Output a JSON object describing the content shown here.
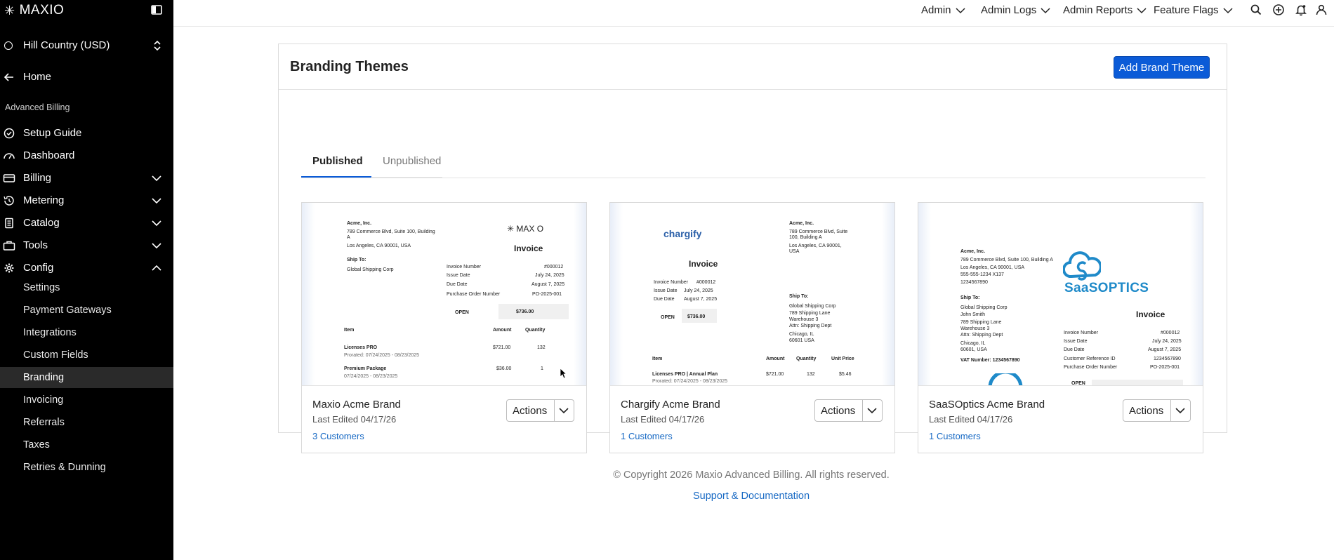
{
  "brand": {
    "name": "MAXIO",
    "mark": "✳"
  },
  "site": {
    "label": "Hill Country (USD)"
  },
  "nav": {
    "home": "Home",
    "section": "Advanced Billing",
    "items": [
      {
        "label": "Setup Guide"
      },
      {
        "label": "Dashboard"
      },
      {
        "label": "Billing"
      },
      {
        "label": "Metering"
      },
      {
        "label": "Catalog"
      },
      {
        "label": "Tools"
      },
      {
        "label": "Config"
      }
    ],
    "config_sub": [
      {
        "label": "Settings"
      },
      {
        "label": "Payment Gateways"
      },
      {
        "label": "Integrations"
      },
      {
        "label": "Custom Fields"
      },
      {
        "label": "Branding"
      },
      {
        "label": "Invoicing"
      },
      {
        "label": "Referrals"
      },
      {
        "label": "Taxes"
      },
      {
        "label": "Retries & Dunning"
      }
    ]
  },
  "topbar": {
    "menus": [
      "Admin",
      "Admin Logs",
      "Admin Reports",
      "Feature Flags"
    ]
  },
  "page": {
    "title": "Branding Themes",
    "add_button": "Add Brand Theme",
    "tabs": [
      "Published",
      "Unpublished"
    ]
  },
  "themes": [
    {
      "name": "Maxio Acme Brand",
      "edited": "Last Edited 04/17/26",
      "customers": "3 Customers",
      "actions": "Actions",
      "preview": {
        "logo": "✳ MAX O",
        "company": [
          "Acme, Inc.",
          "789 Commerce Blvd, Suite 100, Building",
          "A",
          "Los Angeles, CA 90001, USA"
        ],
        "ship_to_label": "Ship To:",
        "ship_to": "Global Shipping Corp",
        "invoice": "Invoice",
        "meta_labels": [
          "Invoice Number",
          "Issue Date",
          "Due Date",
          "Purchase Order Number"
        ],
        "meta_values": [
          "#000012",
          "July 24, 2025",
          "August 7, 2025",
          "PO-2025-001"
        ],
        "open": "OPEN",
        "open_amt": "$736.00",
        "cols": [
          "Item",
          "Amount",
          "Quantity"
        ],
        "row1": [
          "Licenses PRO",
          "$721.00",
          "132"
        ],
        "row1_sub": "Prorated: 07/24/2025 - 08/23/2025",
        "row2": [
          "Premium Package",
          "$36.00",
          "1"
        ],
        "row2_sub": "07/24/2025 - 08/23/2025"
      }
    },
    {
      "name": "Chargify Acme Brand",
      "edited": "Last Edited 04/17/26",
      "customers": "1 Customers",
      "actions": "Actions",
      "preview": {
        "logo": "chargify",
        "company": [
          "Acme, Inc.",
          "789 Commerce Blvd, Suite",
          "100, Building A",
          "Los Angeles, CA 90001,",
          "USA"
        ],
        "invoice": "Invoice",
        "meta_labels": [
          "Invoice Number",
          "Issue Date",
          "Due Date"
        ],
        "meta_values": [
          "#000012",
          "July 24, 2025",
          "August 7, 2025"
        ],
        "open": "OPEN",
        "open_amt": "$736.00",
        "ship_to_label": "Ship To:",
        "ship_to_lines": [
          "Global Shipping Corp",
          "789 Shipping Lane",
          "Warehouse 3",
          "Attn: Shipping Dept",
          "Chicago, IL",
          "60601 USA"
        ],
        "cols": [
          "Item",
          "Amount",
          "Quantity",
          "Unit Price"
        ],
        "row1": [
          "Licenses PRO | Annual Plan",
          "$721.00",
          "132",
          "$5.46"
        ],
        "row1_sub": "Prorated: 07/24/2025 - 08/23/2025"
      }
    },
    {
      "name": "SaaSOptics Acme Brand",
      "edited": "Last Edited 04/17/26",
      "customers": "1 Customers",
      "actions": "Actions",
      "preview": {
        "logo": "SaaSOPTICS",
        "company": [
          "Acme, Inc.",
          "789 Commerce Blvd, Suite 100, Building A",
          "Los Angeles, CA 90001, USA",
          "555-555-1234 X137",
          "1234567890"
        ],
        "ship_to_label": "Ship To:",
        "ship_to_lines": [
          "Global Shipping Corp",
          "John Smith",
          "789 Shipping Lane",
          "Warehouse 3",
          "Attn: Shipping Dept",
          "Chicago, IL",
          "60601, USA"
        ],
        "vat": "VAT Number: 1234567890",
        "invoice": "Invoice",
        "meta_labels": [
          "Invoice Number",
          "Issue Date",
          "Due Date",
          "Customer Reference ID",
          "Purchase Order Number"
        ],
        "meta_values": [
          "#000012",
          "July 24, 2025",
          "August 7, 2025",
          "1234567890",
          "PO-2025-001"
        ],
        "open": "OPEN"
      }
    }
  ],
  "footer": {
    "copyright": "© Copyright 2026 Maxio Advanced Billing. All rights reserved.",
    "link": "Support & Documentation"
  },
  "colors": {
    "primary": "#0b5bd7",
    "link": "#1769c4",
    "sidebar": "#000000"
  }
}
